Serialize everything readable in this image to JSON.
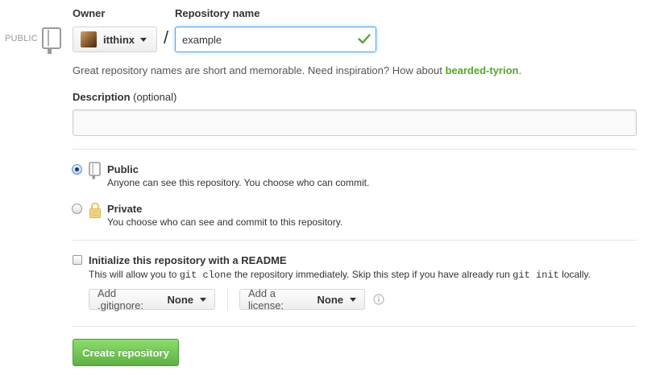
{
  "visibility_tag": "PUBLIC",
  "owner": {
    "label": "Owner",
    "name": "itthinx"
  },
  "repository": {
    "label": "Repository name",
    "slash": "/",
    "value": "example"
  },
  "hint": {
    "text": "Great repository names are short and memorable. Need inspiration? How about ",
    "suggestion": "bearded-tyrion",
    "end": "."
  },
  "description": {
    "label": "Description",
    "optional": "(optional)",
    "value": ""
  },
  "visibility": {
    "selected": "public",
    "public": {
      "title": "Public",
      "desc": "Anyone can see this repository. You choose who can commit."
    },
    "private": {
      "title": "Private",
      "desc": "You choose who can see and commit to this repository."
    }
  },
  "readme": {
    "label": "Initialize this repository with a README",
    "checked": false,
    "desc_pre": "This will allow you to ",
    "code1": "git clone",
    "desc_mid": " the repository immediately. Skip this step if you have already run ",
    "code2": "git init",
    "desc_post": " locally."
  },
  "gitignore": {
    "label": "Add .gitignore:",
    "value": "None"
  },
  "license": {
    "label": "Add a license:",
    "value": "None"
  },
  "create_button": "Create repository",
  "colors": {
    "accent_green": "#55a532",
    "button_green": "#60b044",
    "focus_blue": "#51a7e8"
  },
  "icons": {
    "repo": "repo-book-icon",
    "check": "check-icon",
    "lock": "lock-icon",
    "info": "info-icon",
    "caret": "caret-down-icon"
  }
}
